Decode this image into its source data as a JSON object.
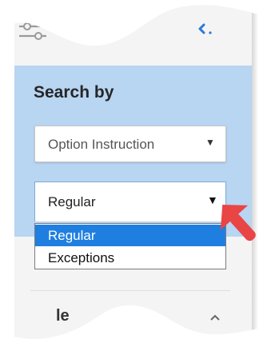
{
  "colors": {
    "panel_bg": "#f4f4f4",
    "criteria_bg": "#b8d5f2",
    "selected_option_bg": "#1f7fe0",
    "link_blue": "#2b7bd6",
    "annotation_arrow": "#e94545"
  },
  "toolbar": {
    "filter_icon": "sliders-icon",
    "collapse_icon": "chevron-left-icon"
  },
  "search": {
    "heading": "Search by",
    "criteria_select": {
      "value": "Option Instruction",
      "icon": "caret-down-icon"
    },
    "mode_select": {
      "value": "Regular",
      "icon": "caret-down-icon",
      "options": [
        {
          "label": "Regular",
          "selected": true
        },
        {
          "label": "Exceptions",
          "selected": false
        }
      ]
    }
  },
  "section": {
    "label_fragment": "le",
    "icon": "chevron-up-icon"
  },
  "annotation": {
    "icon": "red-pointer-arrow"
  }
}
